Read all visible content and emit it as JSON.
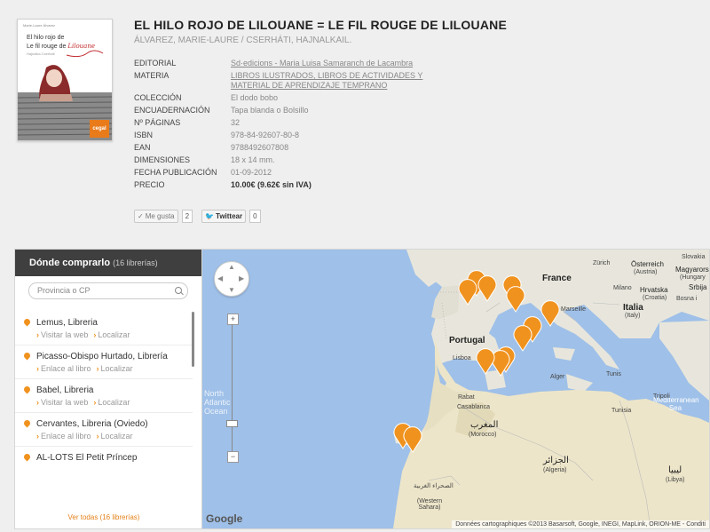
{
  "book": {
    "title": "EL HILO ROJO DE LILOUANE = LE FIL ROUGE DE LILOUANE",
    "authors": "ÁLVAREZ, MARIE-LAURE / CSERHÁTI, HAJNALKAIL.",
    "cover": {
      "author_line": "Marie-Laure Álvarez",
      "title_line1": "El hilo rojo de",
      "title_line2": "Le fil rouge de",
      "script_name": "Lilouane",
      "illustrator": "Hajnalka Cserháti",
      "publisher_logo": "cegal"
    }
  },
  "details": [
    {
      "label": "EDITORIAL",
      "value": "Sd·edicions - Maria Luisa Samaranch de Lacambra",
      "type": "link"
    },
    {
      "label": "MATERIA",
      "value": "LIBROS ILUSTRADOS, LIBROS DE ACTIVIDADES Y MATERIAL DE APRENDIZAJE TEMPRANO",
      "type": "link"
    },
    {
      "label": "COLECCIÓN",
      "value": "El dodo bobo",
      "type": "text"
    },
    {
      "label": "ENCUADERNACIÓN",
      "value": "Tapa blanda o Bolsillo",
      "type": "text"
    },
    {
      "label": "Nº PÁGINAS",
      "value": "32",
      "type": "text"
    },
    {
      "label": "ISBN",
      "value": "978-84-92607-80-8",
      "type": "text"
    },
    {
      "label": "EAN",
      "value": "9788492607808",
      "type": "text"
    },
    {
      "label": "DIMENSIONES",
      "value": "18 x 14 mm.",
      "type": "text"
    },
    {
      "label": "FECHA PUBLICACIÓN",
      "value": "01-09-2012",
      "type": "text"
    },
    {
      "label": "PRECIO",
      "value": "10.00€ (9.62€ sin IVA)",
      "type": "price"
    }
  ],
  "social": {
    "like_label": "Me gusta",
    "like_count": "2",
    "tweet_label": "Twittear",
    "tweet_count": "0"
  },
  "stores": {
    "header": "Dónde comprarlo",
    "count_label": "(16 librerías)",
    "search_placeholder": "Provincia o CP",
    "items": [
      {
        "name": "Lemus, Libreria",
        "action1": "Visitar la web",
        "action2": "Localizar"
      },
      {
        "name": "Picasso-Obispo Hurtado, Librería",
        "action1": "Enlace al libro",
        "action2": "Localizar"
      },
      {
        "name": "Babel, Libreria",
        "action1": "Visitar la web",
        "action2": "Localizar"
      },
      {
        "name": "Cervantes, Libreria (Oviedo)",
        "action1": "Enlace al libro",
        "action2": "Localizar"
      },
      {
        "name": "AL-LOTS El Petit Príncep",
        "action1": "",
        "action2": ""
      }
    ],
    "see_all": "Ver todas (16 librerías)"
  },
  "map": {
    "labels": {
      "france": "France",
      "portugal": "Portugal",
      "italia": "Italia",
      "italy": "(Italy)",
      "osterreich": "Österreich",
      "austria": "(Austria)",
      "magyarorszag": "Magyarors",
      "hungary": "(Hungary",
      "slovensko": "Slovakia",
      "zurich": "Zürich",
      "milano": "Milano",
      "hrvatska": "Hrvatska",
      "croatia": "(Croatia)",
      "bosnia": "Bosna i",
      "srbija": "Srbija",
      "marseille": "Marseille",
      "lisboa": "Lisboa",
      "tunis": "Tunis",
      "tunisia": "Tunisia",
      "alger": "Alger",
      "rabat": "Rabat",
      "casablanca": "Casablanca",
      "morocco_ar": "المغرب",
      "morocco": "(Morocco)",
      "algeria_ar": "الجزائر",
      "algeria": "(Algeria)",
      "libya_ar": "ليبيا",
      "libya": "(Libya)",
      "sahara_ar": "الصحراء الغربية",
      "sahara": "(Western Sahara)",
      "med_sea": "Mediterranean Sea",
      "atlantic": "North Atlantic Ocean",
      "tripoli": "Tripoli"
    },
    "google_logo": "Google",
    "attribution": "Données cartographiques ©2013 Basarsoft, Google, INEGI, MapLink, ORION-ME - Conditi",
    "zoom_in": "+",
    "zoom_out": "−",
    "marker_color": "#f0921e"
  }
}
